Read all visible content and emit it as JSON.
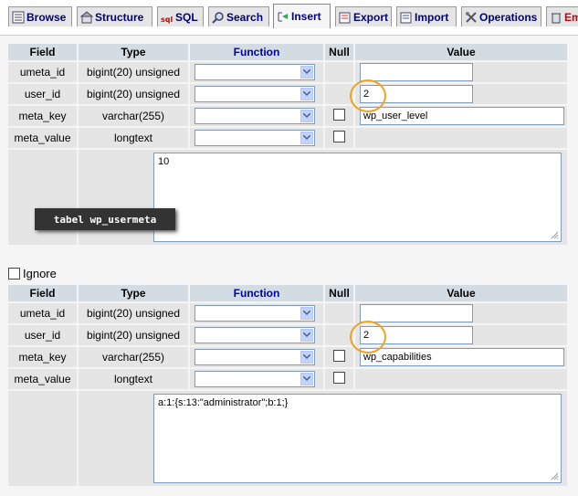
{
  "tabs": [
    {
      "label": "Browse",
      "icon": "browse-icon",
      "active": false
    },
    {
      "label": "Structure",
      "icon": "structure-icon",
      "active": false
    },
    {
      "label": "SQL",
      "icon": "sql-icon",
      "active": false
    },
    {
      "label": "Search",
      "icon": "search-icon",
      "active": false
    },
    {
      "label": "Insert",
      "icon": "insert-icon",
      "active": true
    },
    {
      "label": "Export",
      "icon": "export-icon",
      "active": false
    },
    {
      "label": "Import",
      "icon": "import-icon",
      "active": false
    },
    {
      "label": "Operations",
      "icon": "operations-icon",
      "active": false
    },
    {
      "label": "Em",
      "icon": "empty-icon",
      "active": false
    }
  ],
  "headers": {
    "field": "Field",
    "type": "Type",
    "function": "Function",
    "null": "Null",
    "value": "Value"
  },
  "form1": {
    "rows": [
      {
        "field": "umeta_id",
        "type": "bigint(20) unsigned",
        "value": ""
      },
      {
        "field": "user_id",
        "type": "bigint(20) unsigned",
        "value": "2"
      },
      {
        "field": "meta_key",
        "type": "varchar(255)",
        "value": "wp_user_level"
      },
      {
        "field": "meta_value",
        "type": "longtext",
        "value": "10"
      }
    ]
  },
  "caption": "tabel wp_usermeta",
  "ignore_label": "Ignore",
  "form2": {
    "rows": [
      {
        "field": "umeta_id",
        "type": "bigint(20) unsigned",
        "value": ""
      },
      {
        "field": "user_id",
        "type": "bigint(20) unsigned",
        "value": "2"
      },
      {
        "field": "meta_key",
        "type": "varchar(255)",
        "value": "wp_capabilities"
      },
      {
        "field": "meta_value",
        "type": "longtext",
        "value": "a:1:{s:13:\"administrator\";b:1;}"
      }
    ]
  },
  "colors": {
    "header_bg": "#d3dce3",
    "row_bg": "#e5e5e5",
    "highlight": "#f0a020",
    "function_header": "#0000aa"
  }
}
